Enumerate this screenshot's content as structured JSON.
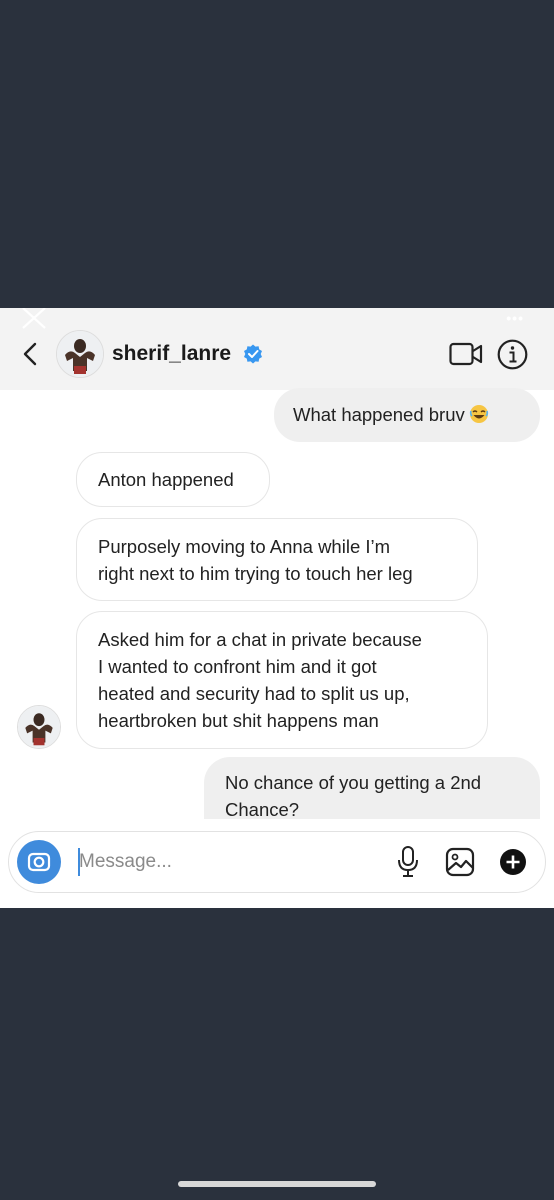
{
  "header": {
    "username": "sherif_lanre",
    "more_label": "•••"
  },
  "messages": [
    {
      "from": "me",
      "text": "What happened bruv"
    },
    {
      "from": "them",
      "text": "Anton happened"
    },
    {
      "from": "them",
      "lines": [
        "Purposely moving to Anna while I’m",
        "right next to him trying to touch her leg"
      ]
    },
    {
      "from": "them",
      "lines": [
        "Asked him for a chat in private because",
        "I wanted to confront him and it got",
        "heated and security had to split us up,",
        "heartbroken but shit happens man"
      ]
    },
    {
      "from": "me",
      "lines": [
        "No chance of you getting a 2nd",
        "Chance?"
      ]
    }
  ],
  "composer": {
    "placeholder": "Message..."
  },
  "icons": {
    "close": "close-icon",
    "back": "chevron-left-icon",
    "verified": "verified-badge-icon",
    "video": "video-call-icon",
    "info": "info-icon",
    "camera": "camera-icon",
    "mic": "microphone-icon",
    "gallery": "gallery-icon",
    "add": "plus-circle-icon",
    "laugh": "laughing-emoji-icon"
  },
  "colors": {
    "background": "#2a313d",
    "verified_blue": "#3897f0",
    "camera_blue": "#3f8bdc",
    "outgoing_bubble": "#efefef"
  }
}
